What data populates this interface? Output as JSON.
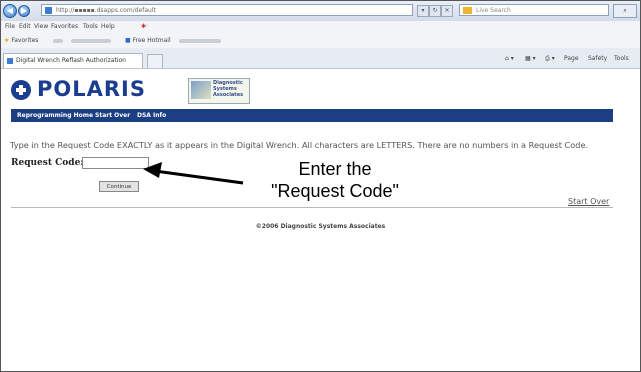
{
  "browser": {
    "url": "http://▪▪▪▪▪.dsapps.com/default",
    "search_placeholder": "Live Search",
    "menu": [
      "File",
      "Edit",
      "View",
      "Favorites",
      "Tools",
      "Help"
    ],
    "favorites_label": "Favorites",
    "favorites_item": "Free Hotmail",
    "tab_title": "Digital Wrench Reflash Authorization",
    "commands": [
      "Page",
      "Safety",
      "Tools"
    ]
  },
  "page": {
    "brand": "POLARIS",
    "dsa_logo_text": "Diagnostic\nSystems\nAssociates",
    "nav": [
      "Reprogramming Home",
      "Start Over",
      "DSA Info"
    ],
    "instruction": "Type in the Request Code EXACTLY as it appears in the Digital Wrench. All characters are LETTERS. There are no numbers in a Request Code.",
    "request_code_label": "Request Code:",
    "request_code_value": "",
    "continue_label": "Continue",
    "start_over_link": "Start Over",
    "copyright": "©2006 Diagnostic Systems Associates"
  },
  "annotation": {
    "line1": "Enter the",
    "line2": "\"Request Code\""
  }
}
